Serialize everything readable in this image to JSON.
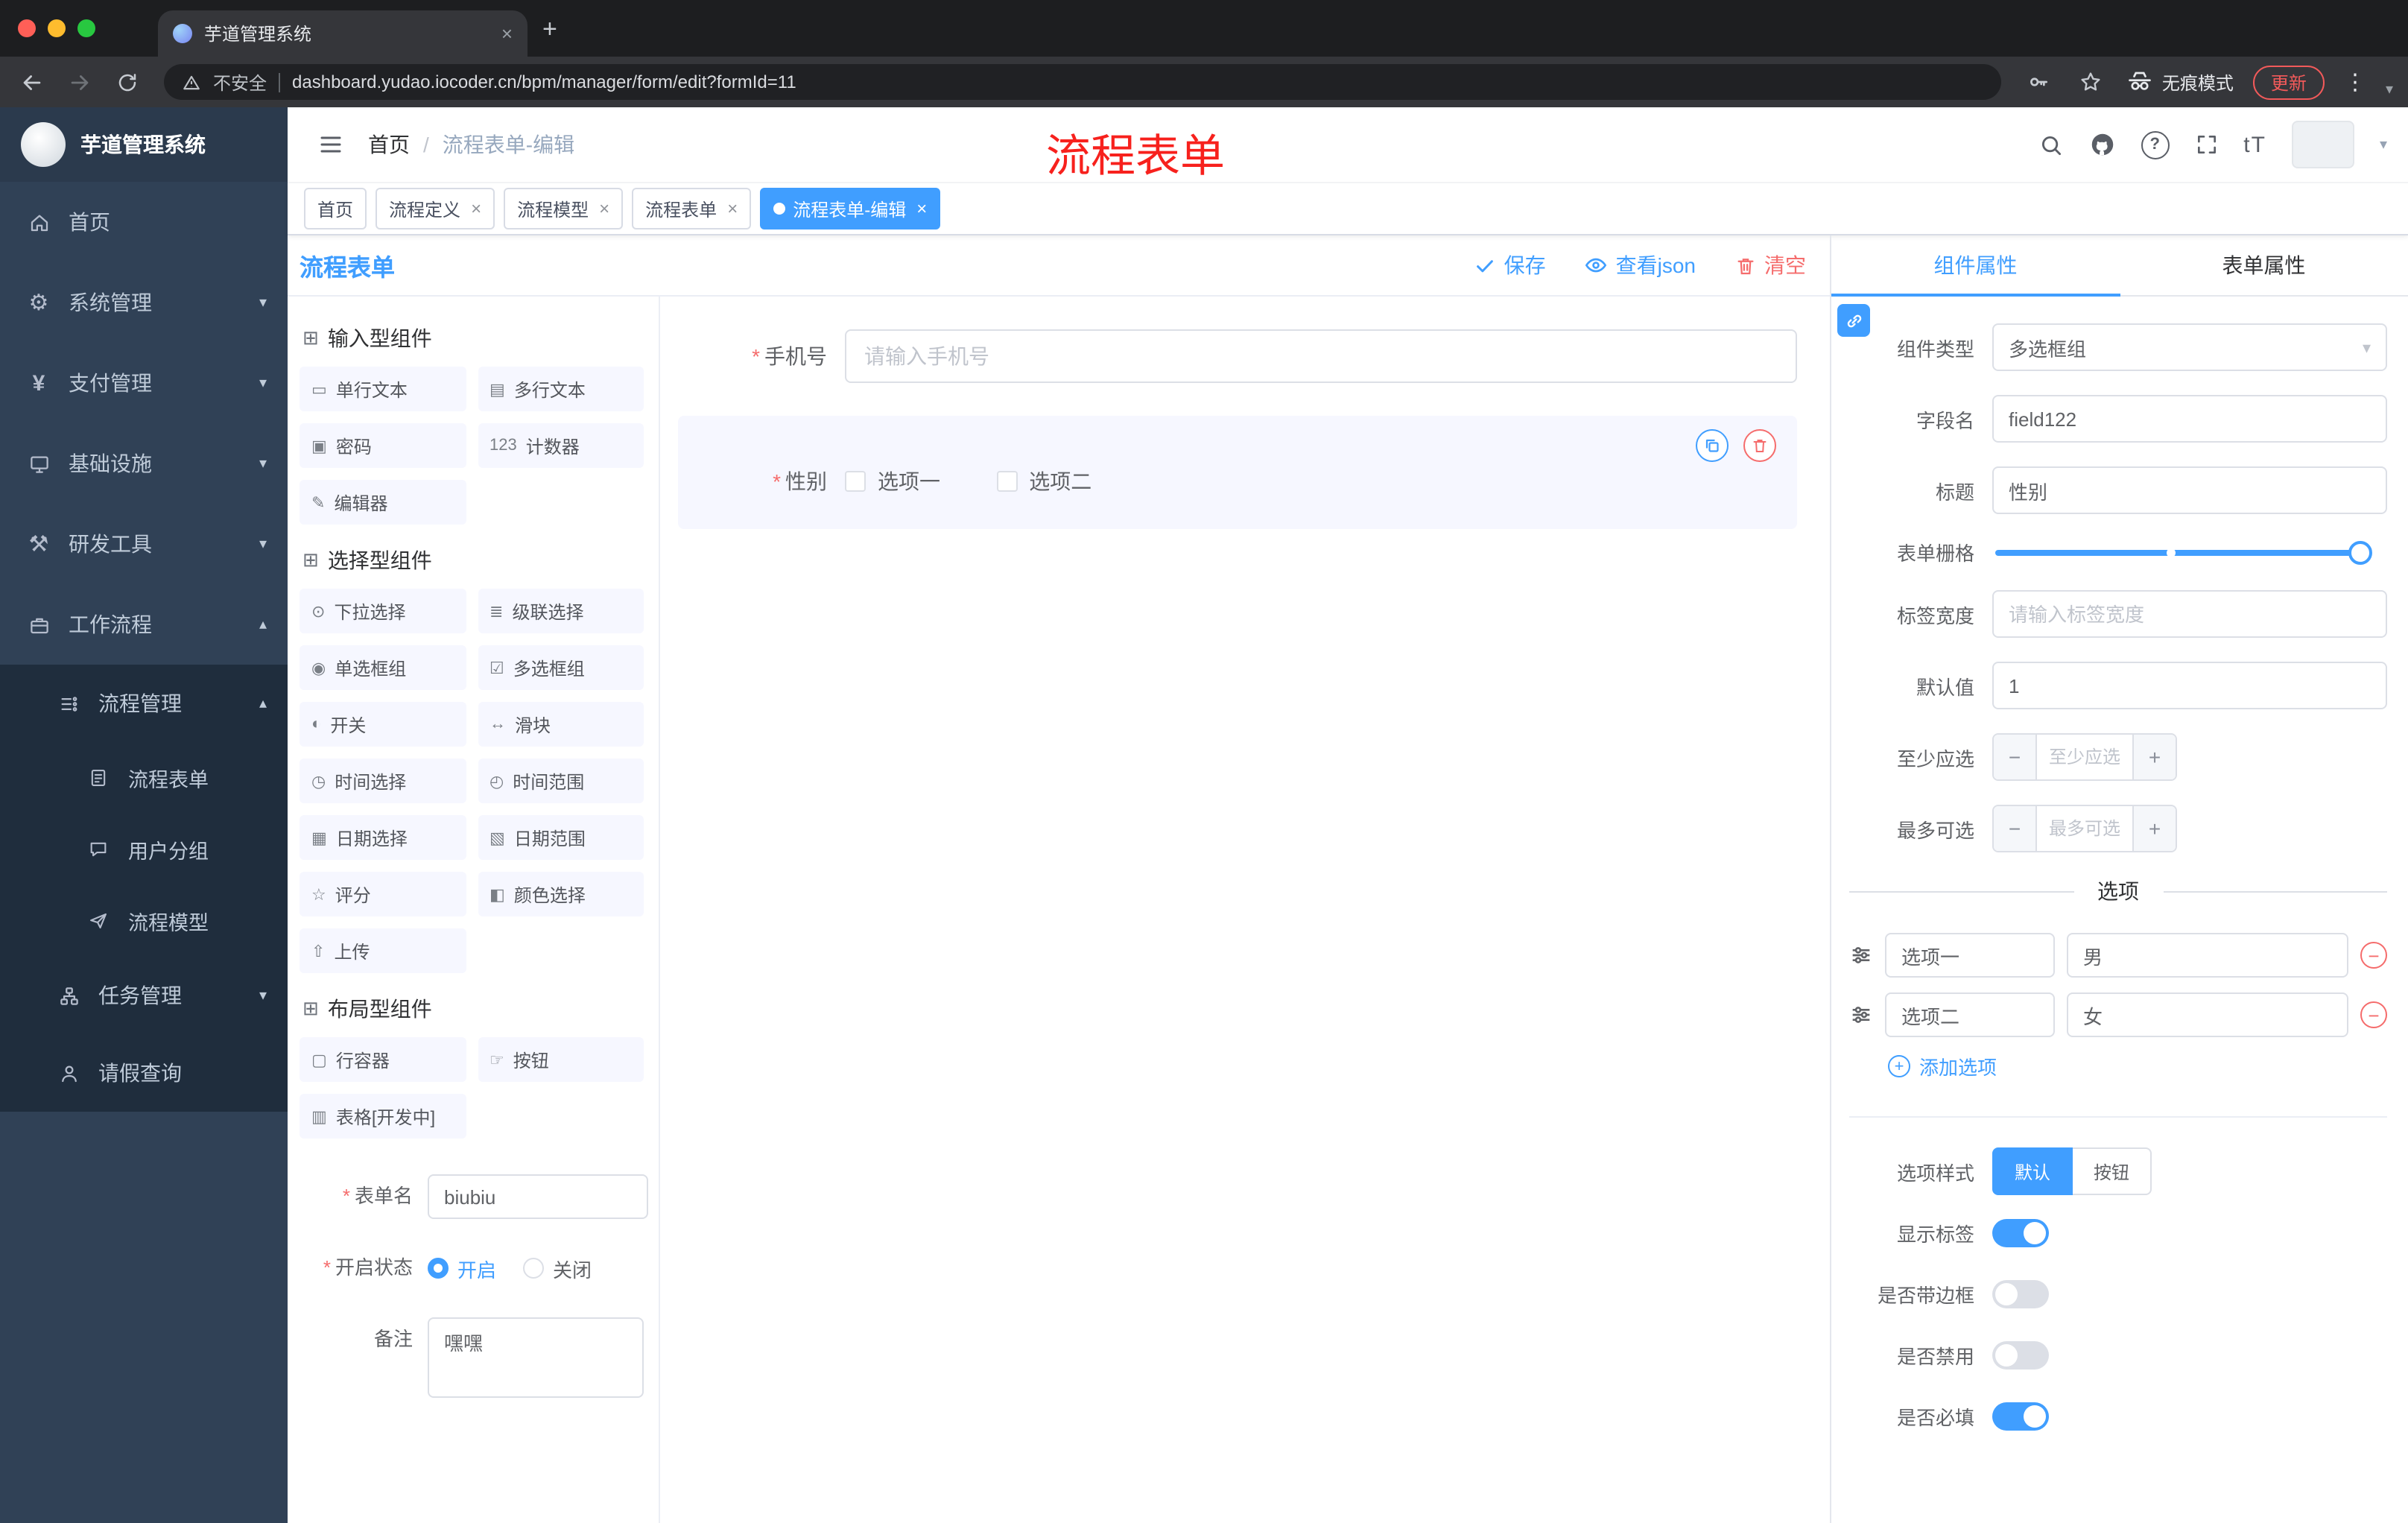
{
  "browser": {
    "tab_title": "芋道管理系统",
    "security_label": "不安全",
    "url": "dashboard.yudao.iocoder.cn/bpm/manager/form/edit?formId=11",
    "incognito_label": "无痕模式",
    "update_label": "更新"
  },
  "sidebar": {
    "logo_title": "芋道管理系统",
    "menu": {
      "home": "首页",
      "system": "系统管理",
      "payment": "支付管理",
      "infra": "基础设施",
      "devtools": "研发工具",
      "workflow": "工作流程",
      "process_mgmt": "流程管理",
      "process_form": "流程表单",
      "user_group": "用户分组",
      "process_model": "流程模型",
      "task_mgmt": "任务管理",
      "leave_query": "请假查询"
    }
  },
  "header": {
    "breadcrumb_home": "首页",
    "breadcrumb_current": "流程表单-编辑",
    "annotation": "流程表单"
  },
  "tags": [
    {
      "label": "首页",
      "active": false,
      "closable": false
    },
    {
      "label": "流程定义",
      "active": false,
      "closable": true
    },
    {
      "label": "流程模型",
      "active": false,
      "closable": true
    },
    {
      "label": "流程表单",
      "active": false,
      "closable": true
    },
    {
      "label": "流程表单-编辑",
      "active": true,
      "closable": true
    }
  ],
  "designer": {
    "title": "流程表单",
    "actions": {
      "save": "保存",
      "view_json": "查看json",
      "clear": "清空"
    },
    "groups": [
      {
        "title": "输入型组件",
        "icon": "input-components-icon",
        "icon_glyph": "⊞",
        "items": [
          {
            "id": "single-text",
            "label": "单行文本",
            "glyph": "▭"
          },
          {
            "id": "multi-text",
            "label": "多行文本",
            "glyph": "▤"
          },
          {
            "id": "password",
            "label": "密码",
            "glyph": "▣"
          },
          {
            "id": "counter",
            "label": "计数器",
            "glyph": "123"
          },
          {
            "id": "editor",
            "label": "编辑器",
            "glyph": "✎"
          }
        ]
      },
      {
        "title": "选择型组件",
        "icon": "select-components-icon",
        "icon_glyph": "⊞",
        "items": [
          {
            "id": "select",
            "label": "下拉选择",
            "glyph": "⊙"
          },
          {
            "id": "cascader",
            "label": "级联选择",
            "glyph": "≣"
          },
          {
            "id": "radio-group",
            "label": "单选框组",
            "glyph": "◉"
          },
          {
            "id": "checkbox-group",
            "label": "多选框组",
            "glyph": "☑"
          },
          {
            "id": "switch",
            "label": "开关",
            "glyph": "◐"
          },
          {
            "id": "slider",
            "label": "滑块",
            "glyph": "↔"
          },
          {
            "id": "time-picker",
            "label": "时间选择",
            "glyph": "◷"
          },
          {
            "id": "time-range",
            "label": "时间范围",
            "glyph": "◴"
          },
          {
            "id": "date-picker",
            "label": "日期选择",
            "glyph": "▦"
          },
          {
            "id": "date-range",
            "label": "日期范围",
            "glyph": "▧"
          },
          {
            "id": "rate",
            "label": "评分",
            "glyph": "☆"
          },
          {
            "id": "color-picker",
            "label": "颜色选择",
            "glyph": "◧"
          },
          {
            "id": "upload",
            "label": "上传",
            "glyph": "⇧"
          }
        ]
      },
      {
        "title": "布局型组件",
        "icon": "layout-components-icon",
        "icon_glyph": "⊞",
        "items": [
          {
            "id": "row-container",
            "label": "行容器",
            "glyph": "▢"
          },
          {
            "id": "button",
            "label": "按钮",
            "glyph": "☞"
          },
          {
            "id": "table",
            "label": "表格[开发中]",
            "glyph": "▥"
          }
        ]
      }
    ],
    "form_meta": {
      "name_label": "表单名",
      "name_value": "biubiu",
      "status_label": "开启状态",
      "status_on": "开启",
      "status_off": "关闭",
      "remark_label": "备注",
      "remark_value": "嘿嘿"
    }
  },
  "canvas": {
    "phone": {
      "label": "手机号",
      "placeholder": "请输入手机号"
    },
    "gender": {
      "label": "性别",
      "options": [
        "选项一",
        "选项二"
      ]
    }
  },
  "panel": {
    "tab_component": "组件属性",
    "tab_form": "表单属性",
    "rows": {
      "component_type": {
        "label": "组件类型",
        "value": "多选框组"
      },
      "field_name": {
        "label": "字段名",
        "value": "field122"
      },
      "title": {
        "label": "标题",
        "value": "性别"
      },
      "form_grid": {
        "label": "表单栅格"
      },
      "label_width": {
        "label": "标签宽度",
        "placeholder": "请输入标签宽度"
      },
      "default_value": {
        "label": "默认值",
        "value": "1"
      },
      "min_select": {
        "label": "至少应选",
        "placeholder": "至少应选"
      },
      "max_select": {
        "label": "最多可选",
        "placeholder": "最多可选"
      }
    },
    "options": {
      "divider": "选项",
      "rows": [
        {
          "label": "选项一",
          "value": "男"
        },
        {
          "label": "选项二",
          "value": "女"
        }
      ],
      "add": "添加选项"
    },
    "option_style": {
      "label": "选项样式",
      "choice_default": "默认",
      "choice_button": "按钮",
      "active": "默认"
    },
    "switches": [
      {
        "label": "显示标签",
        "on": true
      },
      {
        "label": "是否带边框",
        "on": false
      },
      {
        "label": "是否禁用",
        "on": false
      },
      {
        "label": "是否必填",
        "on": true
      }
    ]
  },
  "ui": {
    "required_mark": "*"
  },
  "colors": {
    "accent": "#409eff",
    "danger": "#f56c6c",
    "sidebar_bg": "#304156",
    "submenu_bg": "#1f2d3d",
    "annotation_red": "#f7211d"
  }
}
